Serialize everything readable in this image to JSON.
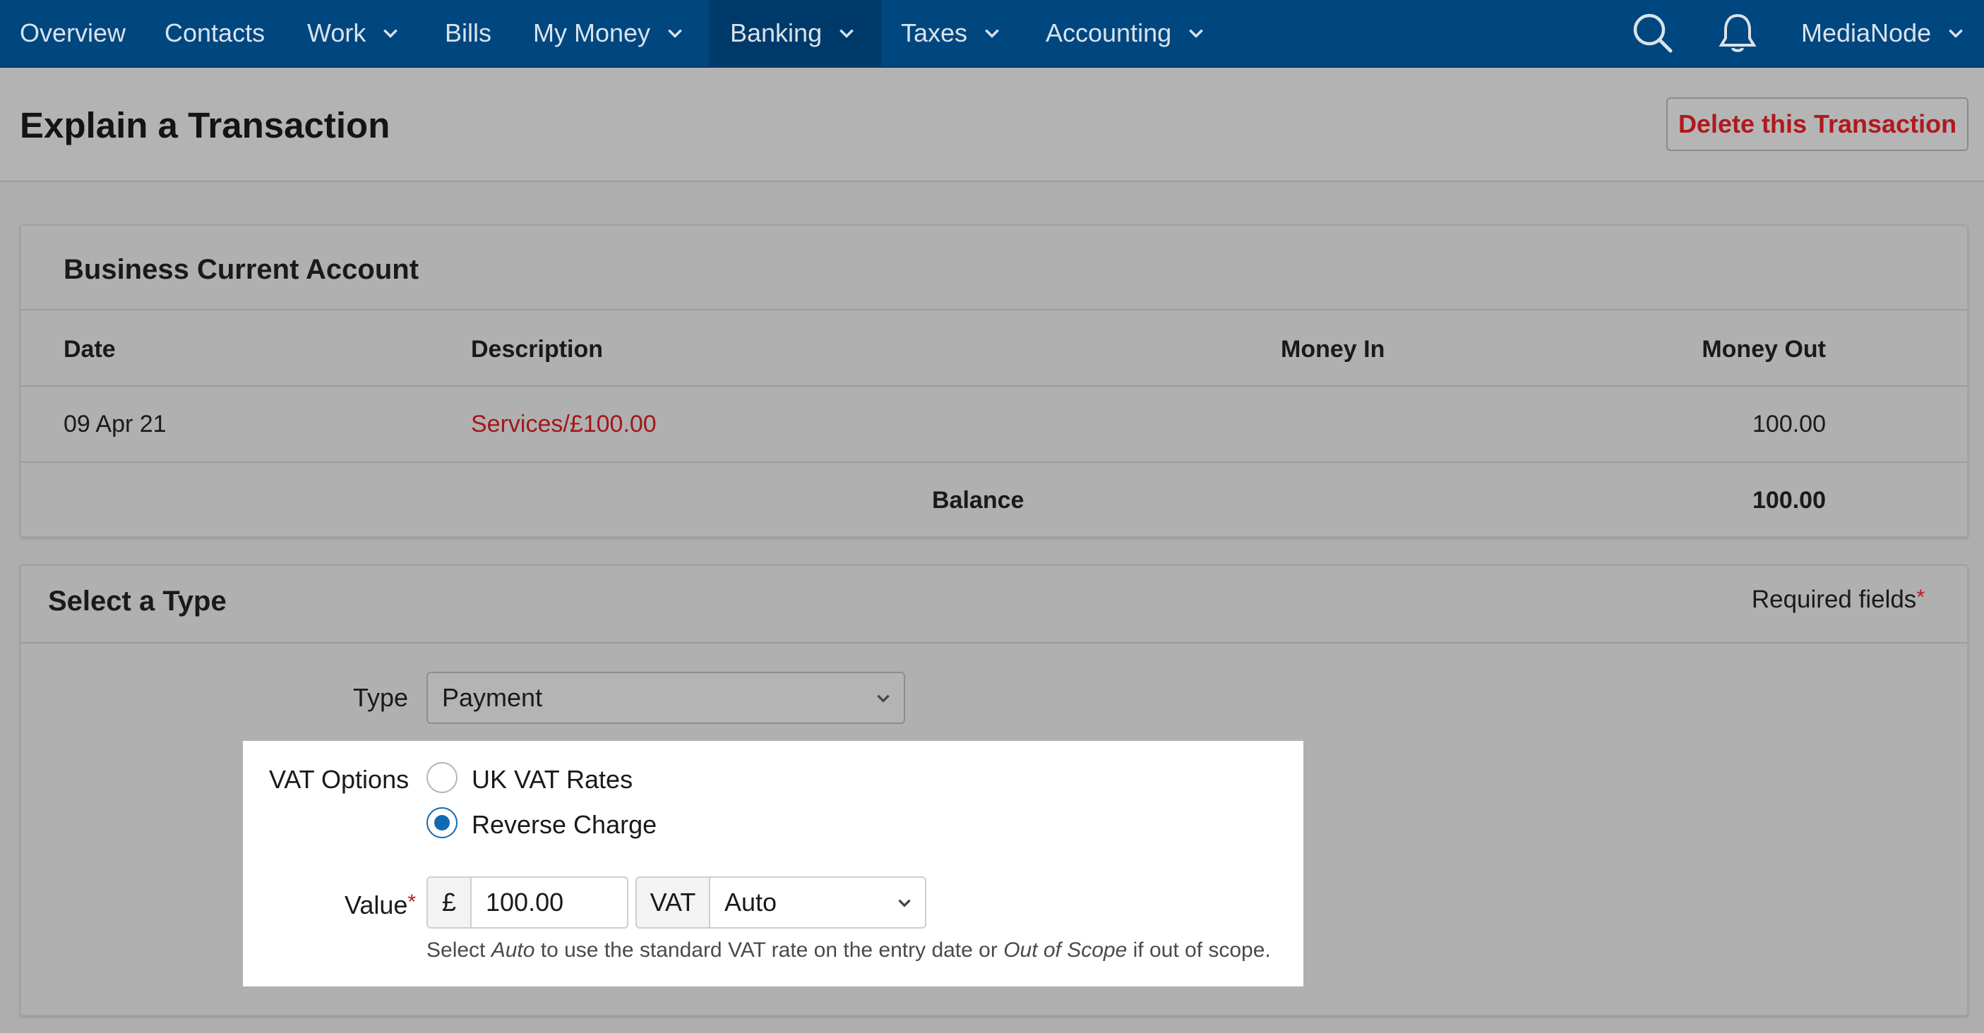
{
  "nav": {
    "items": [
      {
        "label": "Overview",
        "dropdown": false
      },
      {
        "label": "Contacts",
        "dropdown": false
      },
      {
        "label": "Work",
        "dropdown": true
      },
      {
        "label": "Bills",
        "dropdown": false
      },
      {
        "label": "My Money",
        "dropdown": true
      },
      {
        "label": "Banking",
        "dropdown": true,
        "active": true
      },
      {
        "label": "Taxes",
        "dropdown": true
      },
      {
        "label": "Accounting",
        "dropdown": true
      }
    ],
    "account_label": "MediaNode",
    "icons": [
      "search-icon",
      "bell-icon"
    ]
  },
  "header": {
    "title": "Explain a Transaction",
    "delete_label": "Delete this Transaction"
  },
  "account": {
    "title": "Business Current Account",
    "columns": {
      "date": "Date",
      "description": "Description",
      "money_in": "Money In",
      "money_out": "Money Out"
    },
    "row": {
      "date": "09 Apr 21",
      "description": "Services/£100.00",
      "money_in": "",
      "money_out": "100.00"
    },
    "balance_label": "Balance",
    "balance_value": "100.00"
  },
  "type_section": {
    "title": "Select a Type",
    "required_note": "Required fields",
    "required_mark": "*",
    "type_label": "Type",
    "type_value": "Payment",
    "vat_options_label": "VAT Options",
    "vat_options": [
      {
        "label": "UK VAT Rates",
        "checked": false
      },
      {
        "label": "Reverse Charge",
        "checked": true
      }
    ],
    "value_label": "Value",
    "currency_symbol": "£",
    "value": "100.00",
    "vat_addon": "VAT",
    "vat_value": "Auto",
    "help": {
      "part1": "Select ",
      "auto": "Auto",
      "part2": " to use the standard VAT rate on the entry date or ",
      "out_of_scope": "Out of Scope",
      "part3": " if out of scope."
    }
  },
  "colors": {
    "nav_bg": "#00467f",
    "accent_red": "#b0191e",
    "radio_blue": "#0f6ab4"
  }
}
